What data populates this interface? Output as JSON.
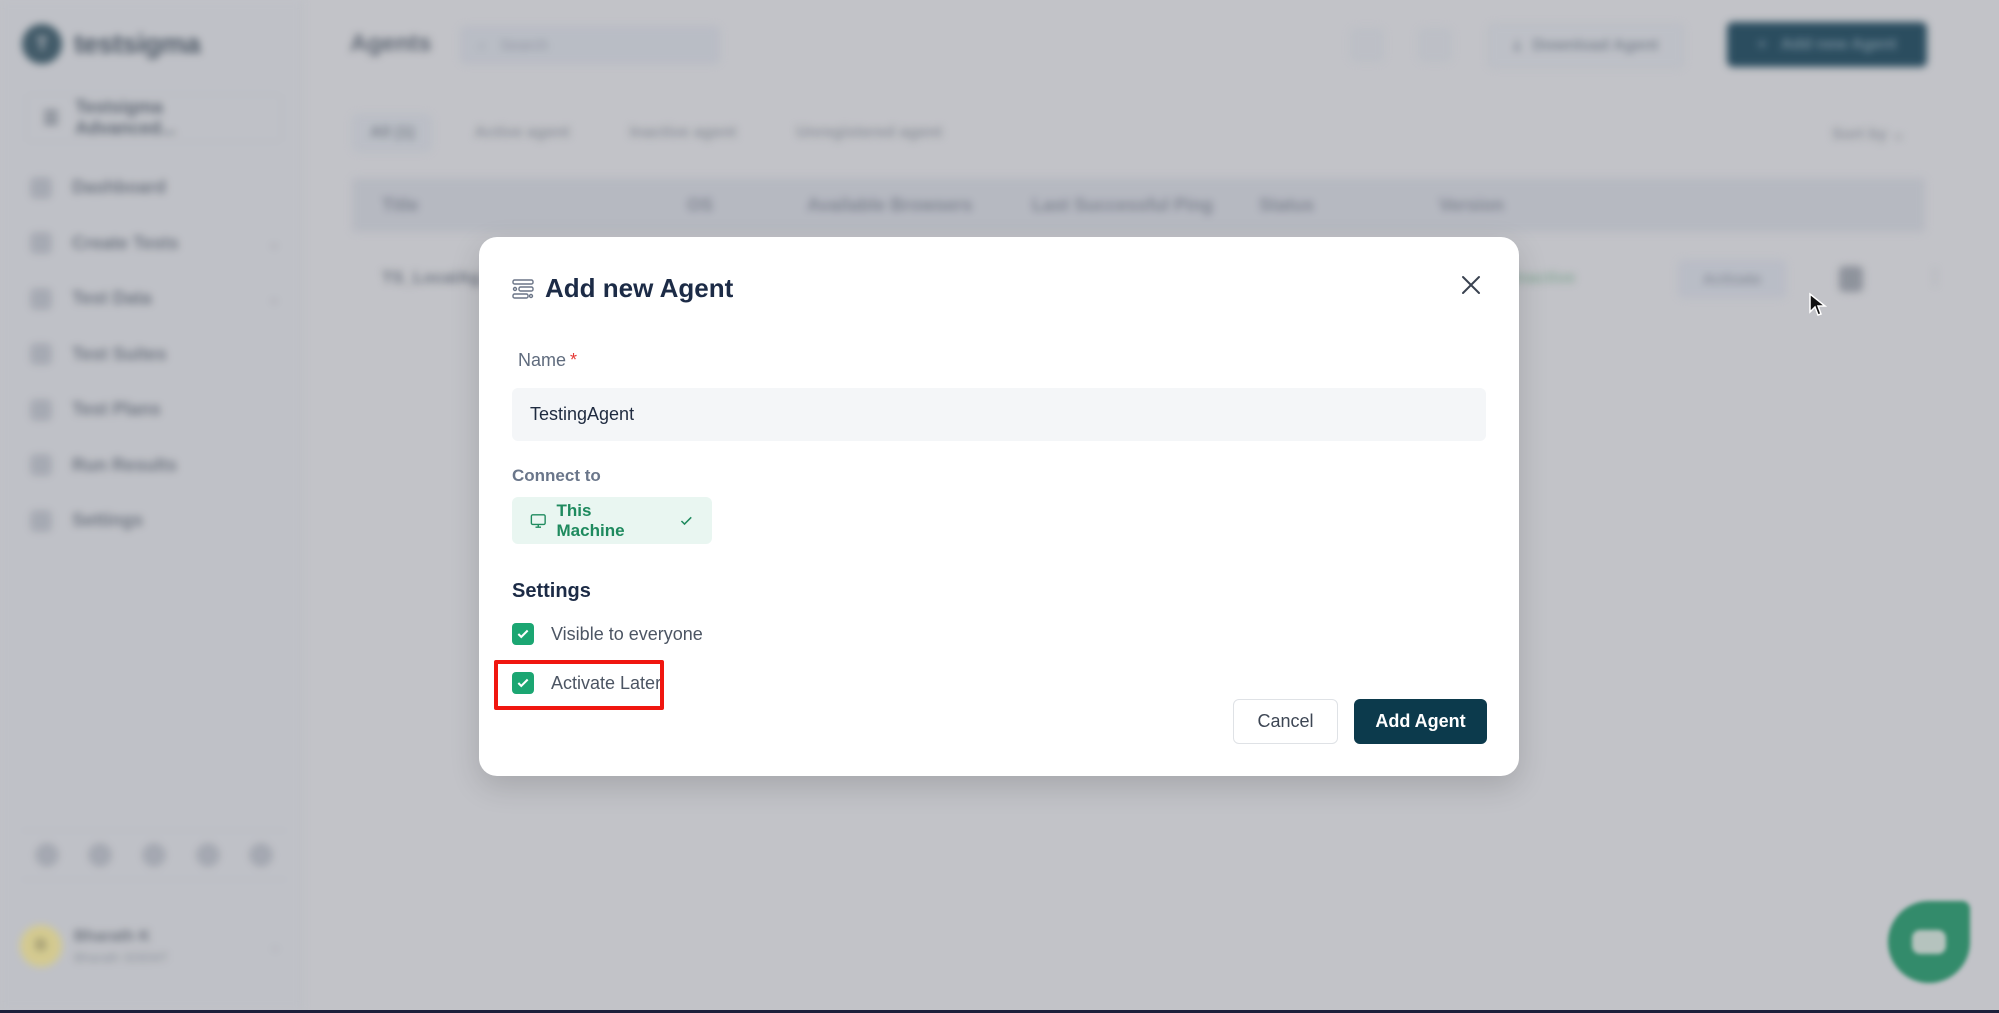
{
  "app": {
    "brand": "testsigma",
    "workspace": "Testsigma Advanced...",
    "page_title": "Agents"
  },
  "sidebar": {
    "items": [
      {
        "label": "Dashboard",
        "icon": "dashboard-icon",
        "expandable": false
      },
      {
        "label": "Create Tests",
        "icon": "create-tests-icon",
        "expandable": true
      },
      {
        "label": "Test Data",
        "icon": "test-data-icon",
        "expandable": true
      },
      {
        "label": "Test Suites",
        "icon": "test-suites-icon",
        "expandable": false
      },
      {
        "label": "Test Plans",
        "icon": "test-plans-icon",
        "expandable": false
      },
      {
        "label": "Run Results",
        "icon": "run-results-icon",
        "expandable": false
      },
      {
        "label": "Settings",
        "icon": "settings-icon",
        "expandable": false
      }
    ],
    "bottom_icons": [
      "docs-icon",
      "help-icon",
      "chat-icon",
      "notifications-icon",
      "apps-icon"
    ],
    "user": {
      "name": "Bharath K",
      "subtitle": "Bharath SDEMT",
      "initial": "B"
    }
  },
  "header": {
    "search_placeholder": "Search",
    "download_label": "Download Agent",
    "add_label": "Add new Agent"
  },
  "tabs": [
    {
      "label": "All (1)",
      "active": true
    },
    {
      "label": "Active agent",
      "active": false
    },
    {
      "label": "Inactive agent",
      "active": false
    },
    {
      "label": "Unregistered agent",
      "active": false
    }
  ],
  "sort_label": "Sort by",
  "table": {
    "columns": [
      "Title",
      "OS",
      "Available Browsers",
      "Last Successful Ping",
      "Status",
      "Version"
    ],
    "rows": [
      {
        "title": "TS_LocalAg...",
        "status": "Inactive",
        "action": "Activate"
      }
    ]
  },
  "modal": {
    "title": "Add new Agent",
    "name_label": "Name",
    "required_mark": "*",
    "name_value": "TestingAgent",
    "connect_label": "Connect to",
    "connect_option": "This Machine",
    "settings_title": "Settings",
    "options": [
      {
        "label": "Visible to everyone",
        "checked": true
      },
      {
        "label": "Activate Later",
        "checked": true
      }
    ],
    "cancel_label": "Cancel",
    "submit_label": "Add Agent"
  },
  "colors": {
    "primary": "#0c3a4c",
    "success": "#1ba672",
    "highlight": "#f0160f",
    "chip_bg": "#e9f6f1"
  }
}
